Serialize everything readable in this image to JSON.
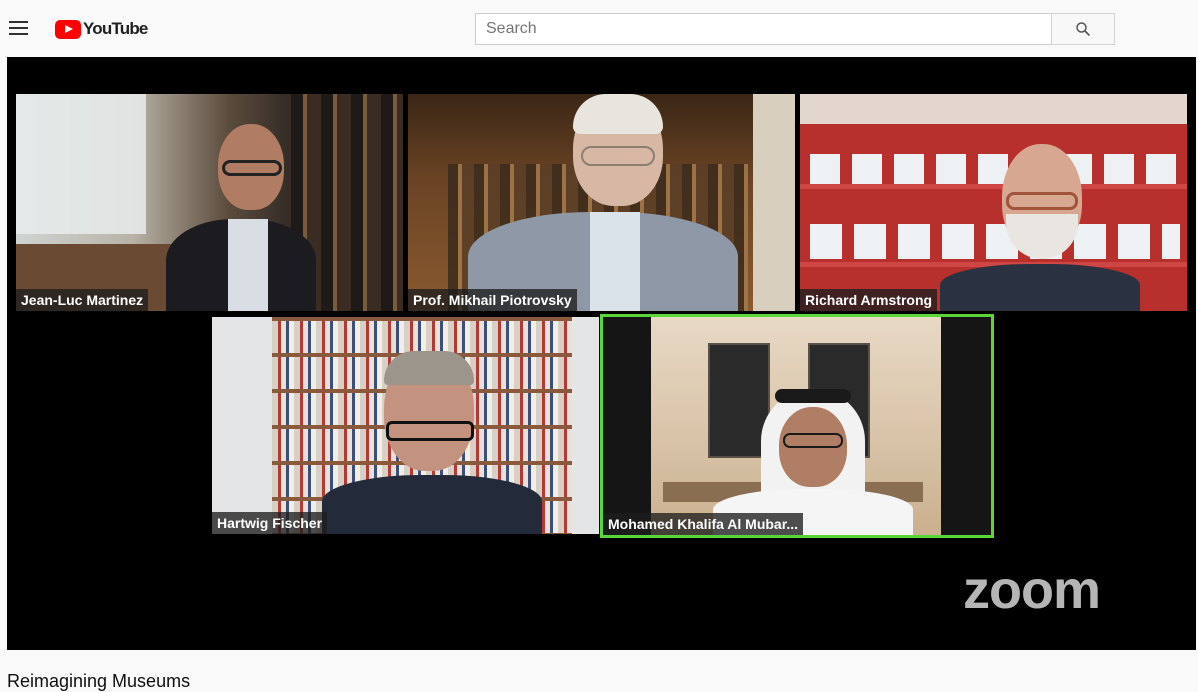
{
  "header": {
    "menu_icon": "hamburger-menu-icon",
    "logo_text": "YouTube",
    "logo_color": "#ff0000",
    "search_placeholder": "Search",
    "search_icon": "search-icon"
  },
  "video": {
    "participants": [
      {
        "name": "Jean-Luc Martinez"
      },
      {
        "name": "Prof. Mikhail Piotrovsky"
      },
      {
        "name": "Richard Armstrong"
      },
      {
        "name": "Hartwig Fischer"
      },
      {
        "name": "Mohamed Khalifa Al Mubar..."
      }
    ],
    "active_speaker_color": "#5bd63a",
    "watermark": "zoom"
  },
  "title": "Reimagining Museums"
}
